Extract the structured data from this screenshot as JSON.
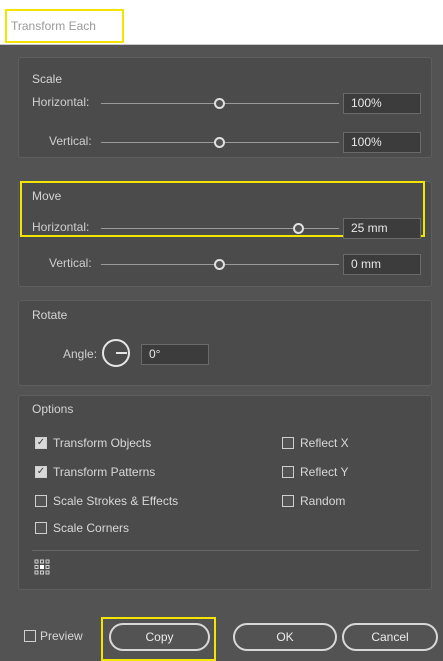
{
  "window": {
    "title": "Transform Each"
  },
  "scale": {
    "heading": "Scale",
    "horizontal": {
      "label": "Horizontal:",
      "value": "100%"
    },
    "vertical": {
      "label": "Vertical:",
      "value": "100%"
    }
  },
  "move": {
    "heading": "Move",
    "horizontal": {
      "label": "Horizontal:",
      "value": "25 mm"
    },
    "vertical": {
      "label": "Vertical:",
      "value": "0 mm"
    }
  },
  "rotate": {
    "heading": "Rotate",
    "angle": {
      "label": "Angle:",
      "value": "0°"
    }
  },
  "options": {
    "heading": "Options",
    "transform_objects": {
      "label": "Transform Objects",
      "checked": true
    },
    "transform_patterns": {
      "label": "Transform Patterns",
      "checked": true
    },
    "scale_strokes": {
      "label": "Scale Strokes & Effects",
      "checked": false
    },
    "scale_corners": {
      "label": "Scale Corners",
      "checked": false
    },
    "reflect_x": {
      "label": "Reflect X",
      "checked": false
    },
    "reflect_y": {
      "label": "Reflect Y",
      "checked": false
    },
    "random": {
      "label": "Random",
      "checked": false
    }
  },
  "footer": {
    "preview": {
      "label": "Preview",
      "checked": false
    },
    "copy_label": "Copy",
    "ok_label": "OK",
    "cancel_label": "Cancel"
  },
  "colors": {
    "highlight": "#f2e600",
    "dialog_bg": "#535353",
    "panel_bg": "#4b4b4b"
  }
}
